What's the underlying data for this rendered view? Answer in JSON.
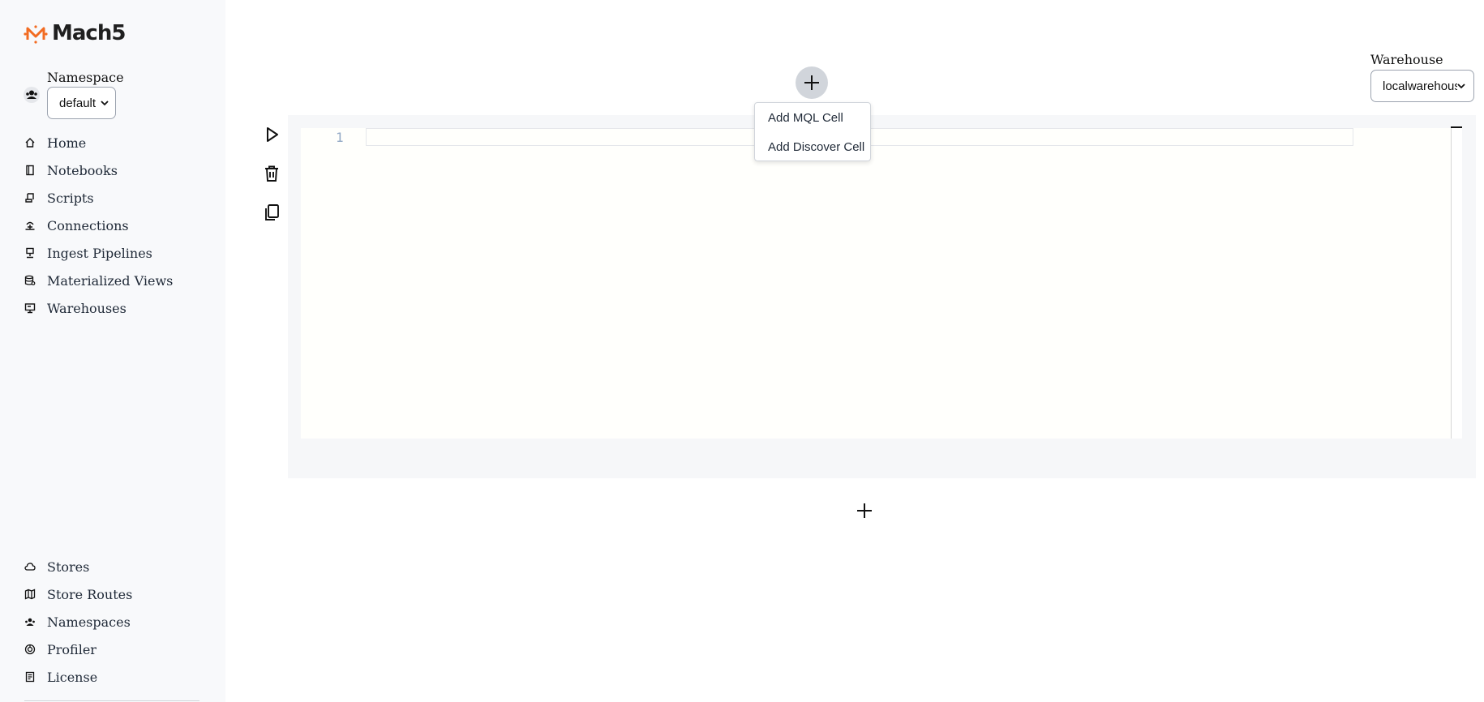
{
  "app": {
    "brand": "Mach5",
    "accent_color": "#f26b21"
  },
  "sidebar": {
    "namespace_label": "Namespace",
    "namespace_value": "default",
    "items": [
      {
        "label": "Home",
        "icon": "home-icon"
      },
      {
        "label": "Notebooks",
        "icon": "notebook-icon"
      },
      {
        "label": "Scripts",
        "icon": "script-icon"
      },
      {
        "label": "Connections",
        "icon": "connection-icon"
      },
      {
        "label": "Ingest Pipelines",
        "icon": "pipeline-icon"
      },
      {
        "label": "Materialized Views",
        "icon": "database-icon"
      },
      {
        "label": "Warehouses",
        "icon": "warehouse-icon"
      }
    ],
    "bottom_items": [
      {
        "label": "Stores",
        "icon": "cloud-icon"
      },
      {
        "label": "Store Routes",
        "icon": "map-icon"
      },
      {
        "label": "Namespaces",
        "icon": "users-icon"
      },
      {
        "label": "Profiler",
        "icon": "profiler-icon"
      },
      {
        "label": "License",
        "icon": "license-icon"
      }
    ]
  },
  "header": {
    "warehouse_label": "Warehouse",
    "warehouse_value": "localwarehouse"
  },
  "editor": {
    "line_number": "1"
  },
  "add_menu": {
    "items": [
      "Add MQL Cell",
      "Add Discover Cell"
    ]
  }
}
